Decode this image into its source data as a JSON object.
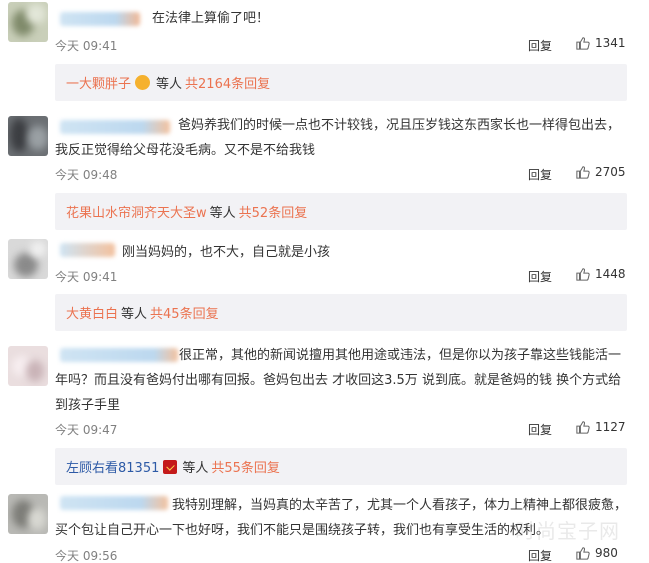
{
  "comments": [
    {
      "text": "在法律上算偷了吧！",
      "time": "今天 09:41",
      "reply_label": "回复",
      "likes": "1341",
      "sub": {
        "user": "一大颗胖子",
        "mid": "等人",
        "count": "共2164条回复"
      }
    },
    {
      "text": "爸妈养我们的时候一点也不计较钱，况且压岁钱这东西家长也一样得包出去，我反正觉得给父母花没毛病。又不是不给我钱",
      "time": "今天 09:48",
      "reply_label": "回复",
      "likes": "2705",
      "sub": {
        "user": "花果山水帘洞齐天大圣w",
        "mid": "等人",
        "count": "共52条回复"
      }
    },
    {
      "text": "刚当妈妈的，也不大，自己就是小孩",
      "time": "今天 09:41",
      "reply_label": "回复",
      "likes": "1448",
      "sub": {
        "user": "大黄白白",
        "mid": "等人",
        "count": "共45条回复"
      }
    },
    {
      "text": "很正常，其他的新闻说擅用其他用途或违法，但是你以为孩子靠这些钱能活一年吗？而且没有爸妈付出哪有回报。爸妈包出去 才收回这3.5万 说到底。就是爸妈的钱 换个方式给到孩子手里",
      "time": "今天 09:47",
      "reply_label": "回复",
      "likes": "1127",
      "sub": {
        "user": "左顾右看81351",
        "mid": "等人",
        "count": "共55条回复"
      }
    },
    {
      "text": "我特别理解，当妈真的太辛苦了，尤其一个人看孩子，体力上精神上都很疲惫，买个包让自己开心一下也好呀，我们不能只是围绕孩子转，我们也有享受生活的权利。",
      "time": "今天 09:56",
      "reply_label": "回复",
      "likes": "980"
    }
  ],
  "icons": {
    "like": "thumbs-up-icon",
    "emoji": "heart-eyes-emoji-icon",
    "badge": "red-badge-icon"
  },
  "colors": {
    "link_orange": "#eb7350",
    "link_blue": "#2d5aa6",
    "sub_bg": "#f2f2f5",
    "time": "#808080"
  },
  "watermark": "时尚宝子网"
}
